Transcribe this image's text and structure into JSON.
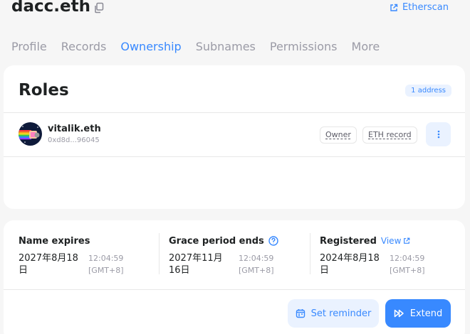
{
  "header": {
    "name": "dacc.eth",
    "etherscan_label": "Etherscan"
  },
  "tabs": [
    {
      "label": "Profile",
      "active": false
    },
    {
      "label": "Records",
      "active": false
    },
    {
      "label": "Ownership",
      "active": true
    },
    {
      "label": "Subnames",
      "active": false
    },
    {
      "label": "Permissions",
      "active": false
    },
    {
      "label": "More",
      "active": false
    }
  ],
  "roles": {
    "title": "Roles",
    "count_badge": "1 address",
    "items": [
      {
        "name": "vitalik.eth",
        "address": "0xd8d...96045",
        "tags": [
          "Owner",
          "ETH record"
        ],
        "menu_icon": "more-vertical-icon"
      }
    ]
  },
  "dates": {
    "expires": {
      "label": "Name expires",
      "date": "2027年8月18日",
      "time": "12:04:59 [GMT+8]"
    },
    "grace": {
      "label": "Grace period ends",
      "date": "2027年11月16日",
      "time": "12:04:59 [GMT+8]",
      "icon": "help-circle-icon"
    },
    "registered": {
      "label": "Registered",
      "link": "View",
      "date": "2024年8月18日",
      "time": "12:04:59 [GMT+8]"
    }
  },
  "actions": {
    "reminder_label": "Set reminder",
    "extend_label": "Extend"
  },
  "colors": {
    "accent": "#3889ff",
    "accent_light": "#eaf2ff",
    "muted": "#9b9ba6",
    "background": "#f6f6f6"
  }
}
